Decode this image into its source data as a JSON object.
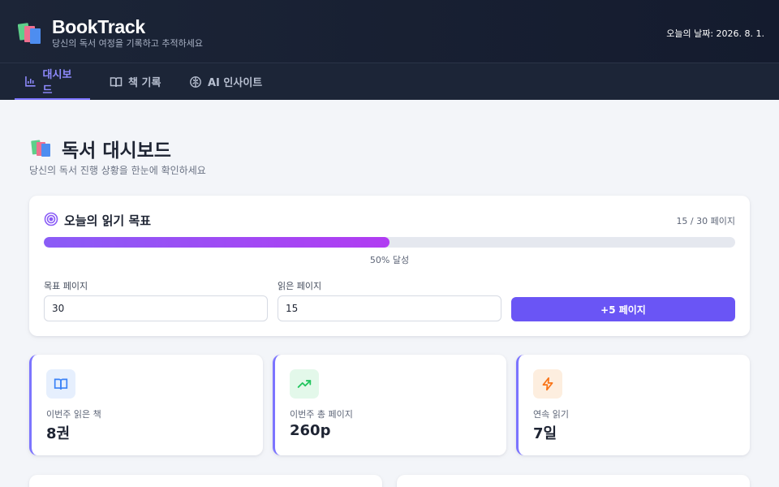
{
  "header": {
    "title": "BookTrack",
    "subtitle": "당신의 독서 여정을 기록하고 추적하세요",
    "today": "오늘의 날짜: 2026. 8. 1."
  },
  "nav": {
    "tabs": [
      {
        "label": "대시보드",
        "icon": "chart-bar-icon",
        "active": true
      },
      {
        "label": "책 기록",
        "icon": "book-open-icon",
        "active": false
      },
      {
        "label": "AI 인사이트",
        "icon": "brain-icon",
        "active": false
      }
    ]
  },
  "page": {
    "title": "독서 대시보드",
    "subtitle": "당신의 독서 진행 상황을 한눈에 확인하세요"
  },
  "goal": {
    "title": "오늘의 읽기 목표",
    "count": "15 / 30 페이지",
    "progress_fraction": 0.5,
    "progress_label": "50% 달성",
    "target_label": "목표 페이지",
    "target_value": "30",
    "read_label": "읽은 페이지",
    "read_value": "15",
    "add_button": "+5 페이지"
  },
  "stats": [
    {
      "label": "이번주 읽은 책",
      "value": "8권",
      "icon": "book-open-icon",
      "color": "#3b82f6",
      "bg": "#e6effd"
    },
    {
      "label": "이번주 총 페이지",
      "value": "260p",
      "icon": "trending-up-icon",
      "color": "#22c55e",
      "bg": "#e3f8ea"
    },
    {
      "label": "연속 읽기",
      "value": "7일",
      "icon": "lightning-icon",
      "color": "#f97316",
      "bg": "#fdeedf"
    }
  ],
  "colors": {
    "accent": "#6a55f5",
    "accent_light": "#7c74ff",
    "header_bg": "#1c2537",
    "page_bg": "#f3f5f9"
  }
}
